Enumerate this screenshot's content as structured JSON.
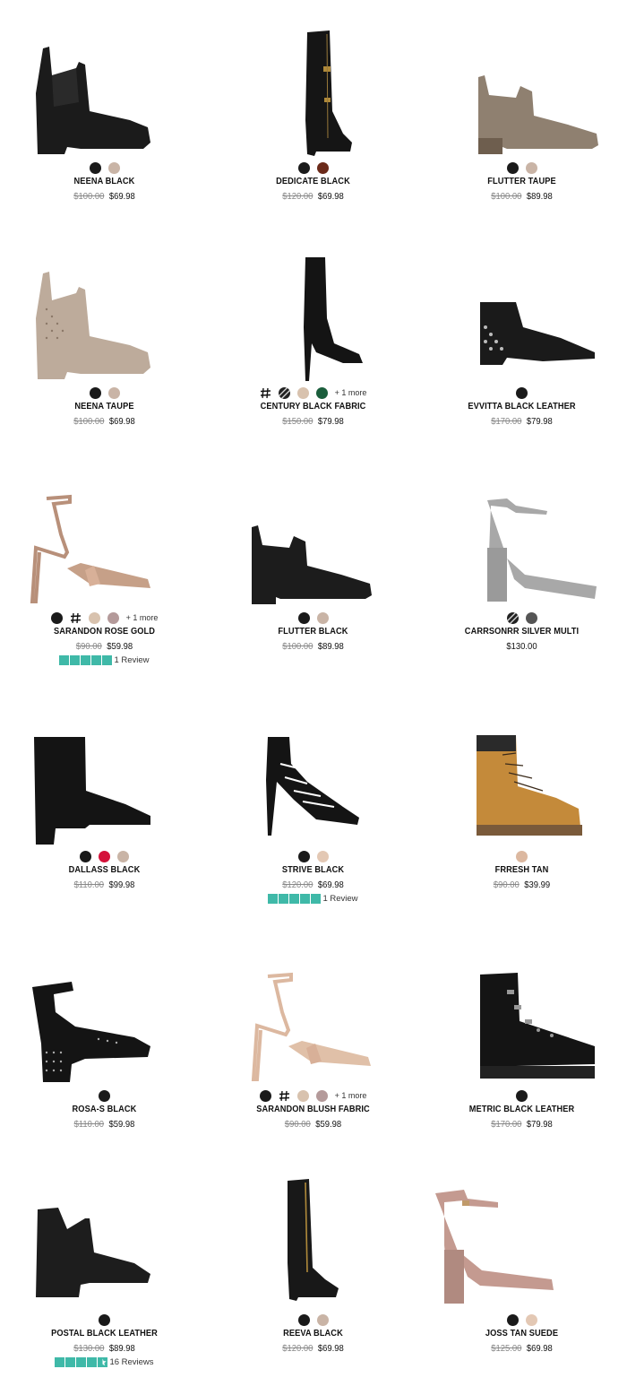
{
  "colors": {
    "rating_star": "#3fb9a8",
    "price_old": "#888888",
    "text": "#111111"
  },
  "products": [
    {
      "name": "NEENA BLACK",
      "old_price": "$100.00",
      "price": "$69.98",
      "swatches": [
        "#1a1a1a",
        "#c9b4a6"
      ],
      "more": "",
      "rating": null,
      "reviews": ""
    },
    {
      "name": "DEDICATE BLACK",
      "old_price": "$120.00",
      "price": "$69.98",
      "swatches": [
        "#1a1a1a",
        "#6b2a1a"
      ],
      "more": "",
      "rating": null,
      "reviews": ""
    },
    {
      "name": "FLUTTER TAUPE",
      "old_price": "$100.00",
      "price": "$89.98",
      "swatches": [
        "#1a1a1a",
        "#c9b4a6"
      ],
      "more": "",
      "rating": null,
      "reviews": ""
    },
    {
      "name": "NEENA TAUPE",
      "old_price": "$100.00",
      "price": "$69.98",
      "swatches": [
        "#1a1a1a",
        "#c9b4a6"
      ],
      "more": "",
      "rating": null,
      "reviews": ""
    },
    {
      "name": "CENTURY BLACK FABRIC",
      "old_price": "$150.00",
      "price": "$79.98",
      "swatches": [
        "pattern-hash",
        "pattern-stripe",
        "#d8c2ae",
        "#1b5e3c"
      ],
      "more": "+ 1 more",
      "rating": null,
      "reviews": ""
    },
    {
      "name": "EVVITTA BLACK LEATHER",
      "old_price": "$170.00",
      "price": "$79.98",
      "swatches": [
        "#1a1a1a"
      ],
      "more": "",
      "rating": null,
      "reviews": ""
    },
    {
      "name": "SARANDON ROSE GOLD",
      "old_price": "$90.00",
      "price": "$59.98",
      "swatches": [
        "#1a1a1a",
        "pattern-hash",
        "#d8c2ae",
        "#b49a9a"
      ],
      "more": "+ 1 more",
      "rating": 5,
      "reviews": "1 Review"
    },
    {
      "name": "FLUTTER BLACK",
      "old_price": "$100.00",
      "price": "$89.98",
      "swatches": [
        "#1a1a1a",
        "#c9b4a6"
      ],
      "more": "",
      "rating": null,
      "reviews": ""
    },
    {
      "name": "CARRSONRR SILVER MULTI",
      "old_price": "",
      "price": "$130.00",
      "swatches": [
        "pattern-stripe",
        "#555555"
      ],
      "more": "",
      "rating": null,
      "reviews": ""
    },
    {
      "name": "DALLASS BLACK",
      "old_price": "$110.00",
      "price": "$99.98",
      "swatches": [
        "#1a1a1a",
        "#d4123a",
        "#c9b4a6"
      ],
      "more": "",
      "rating": null,
      "reviews": ""
    },
    {
      "name": "STRIVE BLACK",
      "old_price": "$120.00",
      "price": "$69.98",
      "swatches": [
        "#1a1a1a",
        "#e3c8b4"
      ],
      "more": "",
      "rating": 5,
      "reviews": "1 Review"
    },
    {
      "name": "FRRESH TAN",
      "old_price": "$90.00",
      "price": "$39.99",
      "swatches": [
        "#dcb8a0"
      ],
      "more": "",
      "rating": null,
      "reviews": ""
    },
    {
      "name": "ROSA-S BLACK",
      "old_price": "$110.00",
      "price": "$59.98",
      "swatches": [
        "#1a1a1a"
      ],
      "more": "",
      "rating": null,
      "reviews": ""
    },
    {
      "name": "SARANDON BLUSH FABRIC",
      "old_price": "$90.00",
      "price": "$59.98",
      "swatches": [
        "#1a1a1a",
        "pattern-hash",
        "#d8c2ae",
        "#b49a9a"
      ],
      "more": "+ 1 more",
      "rating": null,
      "reviews": ""
    },
    {
      "name": "METRIC BLACK LEATHER",
      "old_price": "$170.00",
      "price": "$79.98",
      "swatches": [
        "#1a1a1a"
      ],
      "more": "",
      "rating": null,
      "reviews": ""
    },
    {
      "name": "POSTAL BLACK LEATHER",
      "old_price": "$130.00",
      "price": "$89.98",
      "swatches": [
        "#1a1a1a"
      ],
      "more": "",
      "rating": 4.5,
      "reviews": "16 Reviews"
    },
    {
      "name": "REEVA BLACK",
      "old_price": "$120.00",
      "price": "$69.98",
      "swatches": [
        "#1a1a1a",
        "#c9b4a6"
      ],
      "more": "",
      "rating": null,
      "reviews": ""
    },
    {
      "name": "JOSS TAN SUEDE",
      "old_price": "$125.00",
      "price": "$69.98",
      "swatches": [
        "#1a1a1a",
        "#e3c8b4"
      ],
      "more": "",
      "rating": null,
      "reviews": ""
    }
  ]
}
